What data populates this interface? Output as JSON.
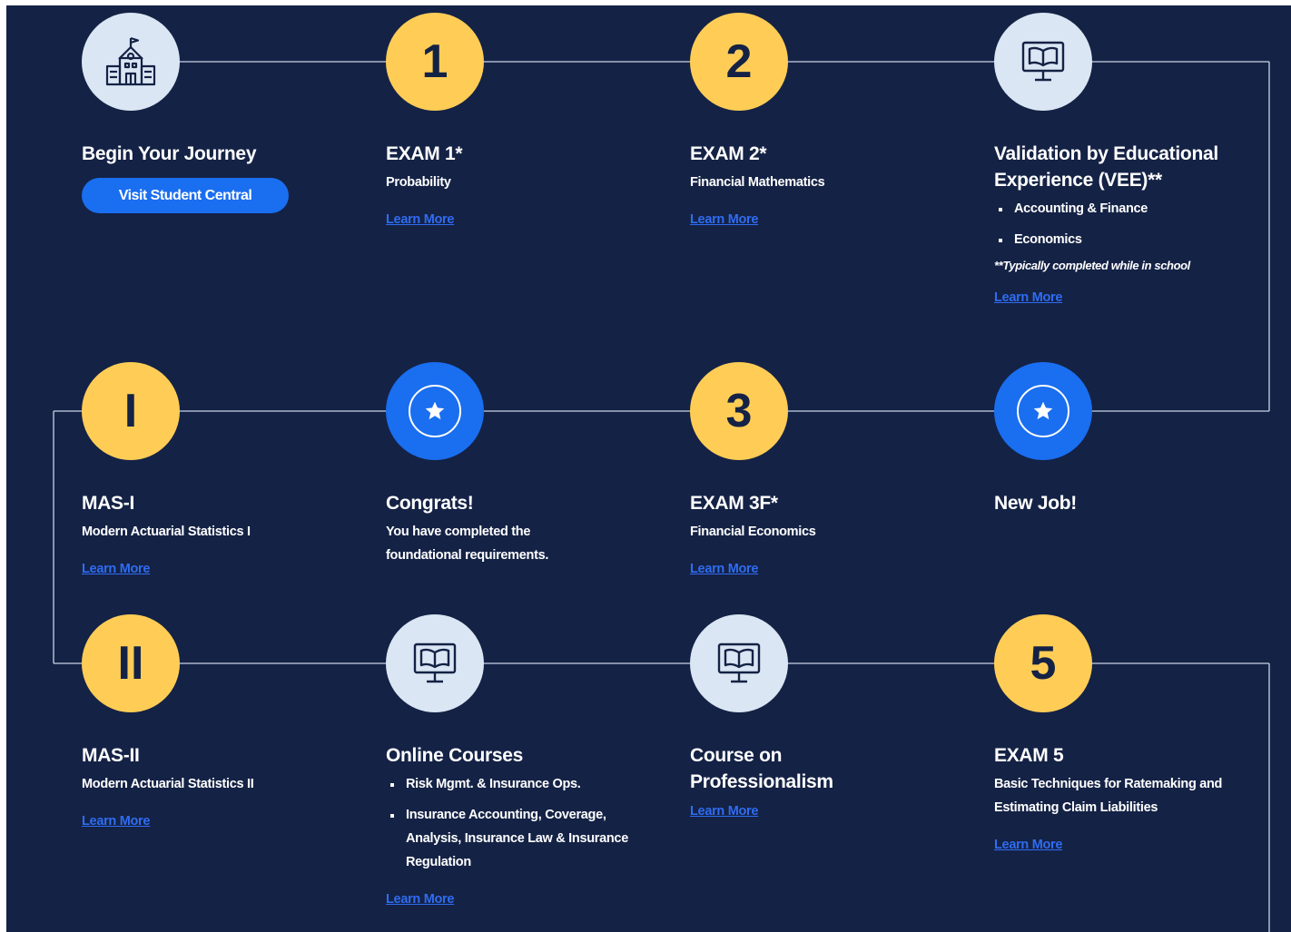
{
  "steps": {
    "begin": {
      "title": "Begin Your Journey",
      "button": "Visit Student Central"
    },
    "exam1": {
      "numeral": "1",
      "title": "EXAM 1*",
      "sub": "Probability",
      "link": "Learn More"
    },
    "exam2": {
      "numeral": "2",
      "title": "EXAM 2*",
      "sub": "Financial Mathematics",
      "link": "Learn More"
    },
    "vee": {
      "title": "Validation by Educational Experience (VEE)**",
      "items": [
        "Accounting & Finance",
        "Economics"
      ],
      "note": "**Typically completed while in school",
      "link": "Learn More"
    },
    "mas1": {
      "numeral": "I",
      "title": "MAS-I",
      "sub": "Modern Actuarial Statistics I",
      "link": "Learn More"
    },
    "congrats": {
      "title": "Congrats!",
      "sub": "You have completed the foundational requirements."
    },
    "exam3f": {
      "numeral": "3",
      "title": "EXAM 3F*",
      "sub": "Financial Economics",
      "link": "Learn More"
    },
    "newjob": {
      "title": "New Job!"
    },
    "mas2": {
      "numeral": "II",
      "title": "MAS-II",
      "sub": "Modern Actuarial Statistics II",
      "link": "Learn More"
    },
    "online": {
      "title": "Online Courses",
      "items": [
        "Risk Mgmt. & Insurance Ops.",
        "Insurance Accounting, Coverage, Analysis, Insurance Law & Insurance Regulation"
      ],
      "link": "Learn More"
    },
    "prof": {
      "title": "Course on Professionalism",
      "link": "Learn More"
    },
    "exam5": {
      "numeral": "5",
      "title": "EXAM 5",
      "sub": "Basic Techniques for Ratemaking and Estimating Claim Liabilities",
      "link": "Learn More"
    }
  },
  "colors": {
    "background": "#142245",
    "milestone": "#ffcd56",
    "celebration": "#1a6ef0",
    "course": "#dbe6f4",
    "link": "#2f6cf2"
  },
  "icons": [
    "school-building-icon",
    "star-icon",
    "monitor-book-icon"
  ]
}
